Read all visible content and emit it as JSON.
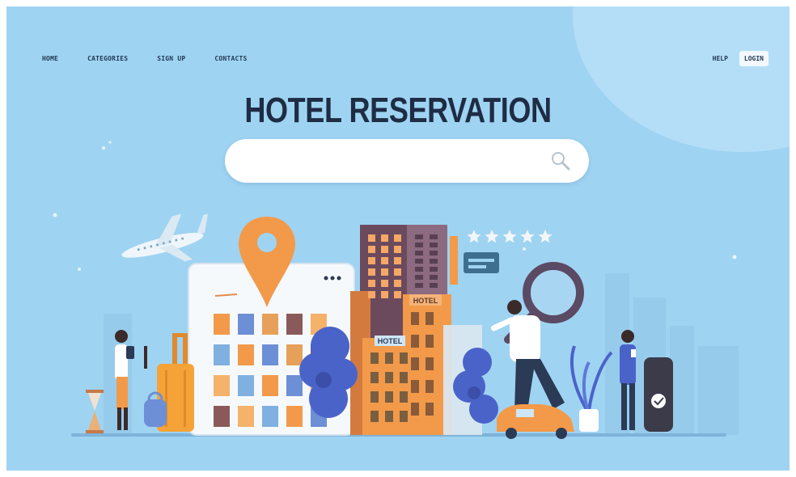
{
  "nav": {
    "items": [
      {
        "label": "HOME"
      },
      {
        "label": "CATEGORIES"
      },
      {
        "label": "SIGN UP"
      },
      {
        "label": "CONTACTS"
      }
    ],
    "help_label": "HELP",
    "login_label": "LOGIN"
  },
  "hero": {
    "title": "HOTEL RESERVATION"
  },
  "search": {
    "placeholder": "",
    "icon": "search-icon"
  },
  "illustration": {
    "hotel_signs": [
      "HOTEL",
      "HOTEL"
    ],
    "rating_stars": 5
  },
  "colors": {
    "background": "#9fd3f2",
    "title": "#1e2c44",
    "accent_orange": "#f29a4a",
    "building_purple": "#6b4a5e",
    "tree_blue": "#4a63c9"
  }
}
